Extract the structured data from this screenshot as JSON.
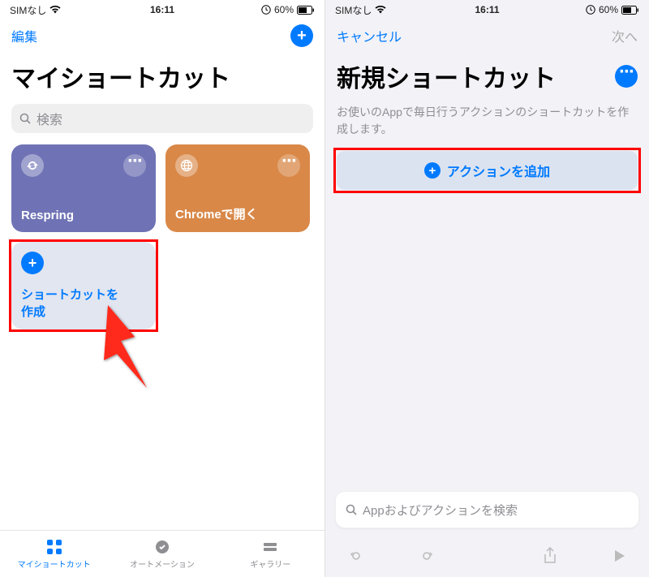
{
  "status": {
    "carrier": "SIMなし",
    "time": "16:11",
    "battery": "60%"
  },
  "left": {
    "edit": "編集",
    "title": "マイショートカット",
    "search_placeholder": "検索",
    "cards": {
      "respring": "Respring",
      "chrome": "Chromeで開く",
      "create_line1": "ショートカットを",
      "create_line2": "作成"
    },
    "tabs": {
      "shortcuts": "マイショートカット",
      "automation": "オートメーション",
      "gallery": "ギャラリー"
    }
  },
  "right": {
    "cancel": "キャンセル",
    "next": "次へ",
    "title": "新規ショートカット",
    "description": "お使いのAppで毎日行うアクションのショートカットを作成します。",
    "add_action": "アクションを追加",
    "search_placeholder": "Appおよびアクションを検索"
  }
}
